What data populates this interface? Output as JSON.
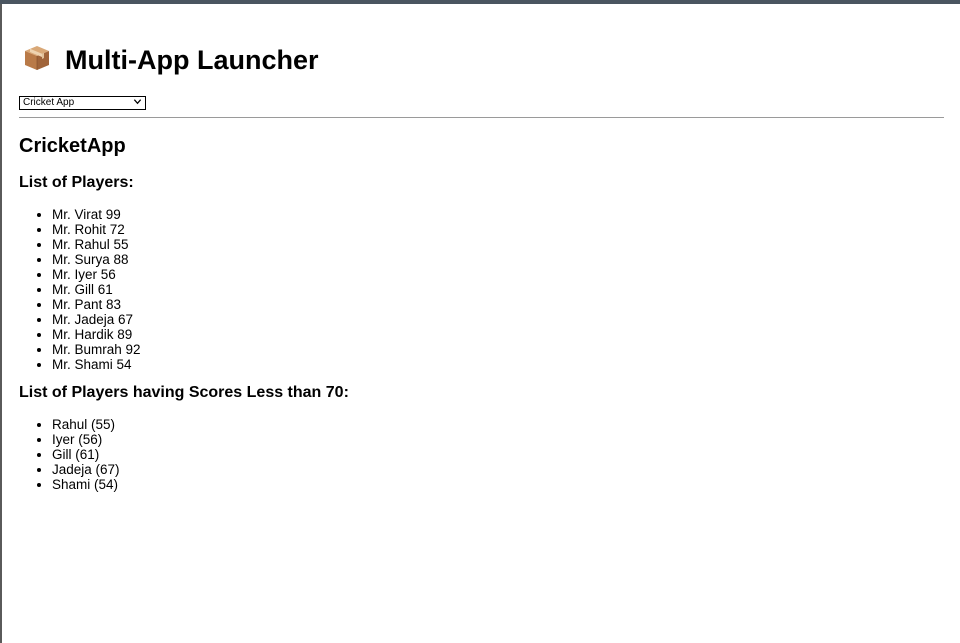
{
  "header": {
    "icon": "package-icon",
    "title": "Multi-App Launcher"
  },
  "app_selector": {
    "selected": "Cricket App",
    "options": [
      "Cricket App"
    ]
  },
  "app": {
    "title": "CricketApp",
    "all_players": {
      "heading": "List of Players:",
      "items": [
        "Mr. Virat 99",
        "Mr. Rohit 72",
        "Mr. Rahul 55",
        "Mr. Surya 88",
        "Mr. Iyer 56",
        "Mr. Gill 61",
        "Mr. Pant 83",
        "Mr. Jadeja 67",
        "Mr. Hardik 89",
        "Mr. Bumrah 92",
        "Mr. Shami 54"
      ]
    },
    "low_scorers": {
      "heading": "List of Players having Scores Less than 70:",
      "items": [
        "Rahul (55)",
        "Iyer (56)",
        "Gill (61)",
        "Jadeja (67)",
        "Shami (54)"
      ]
    }
  }
}
